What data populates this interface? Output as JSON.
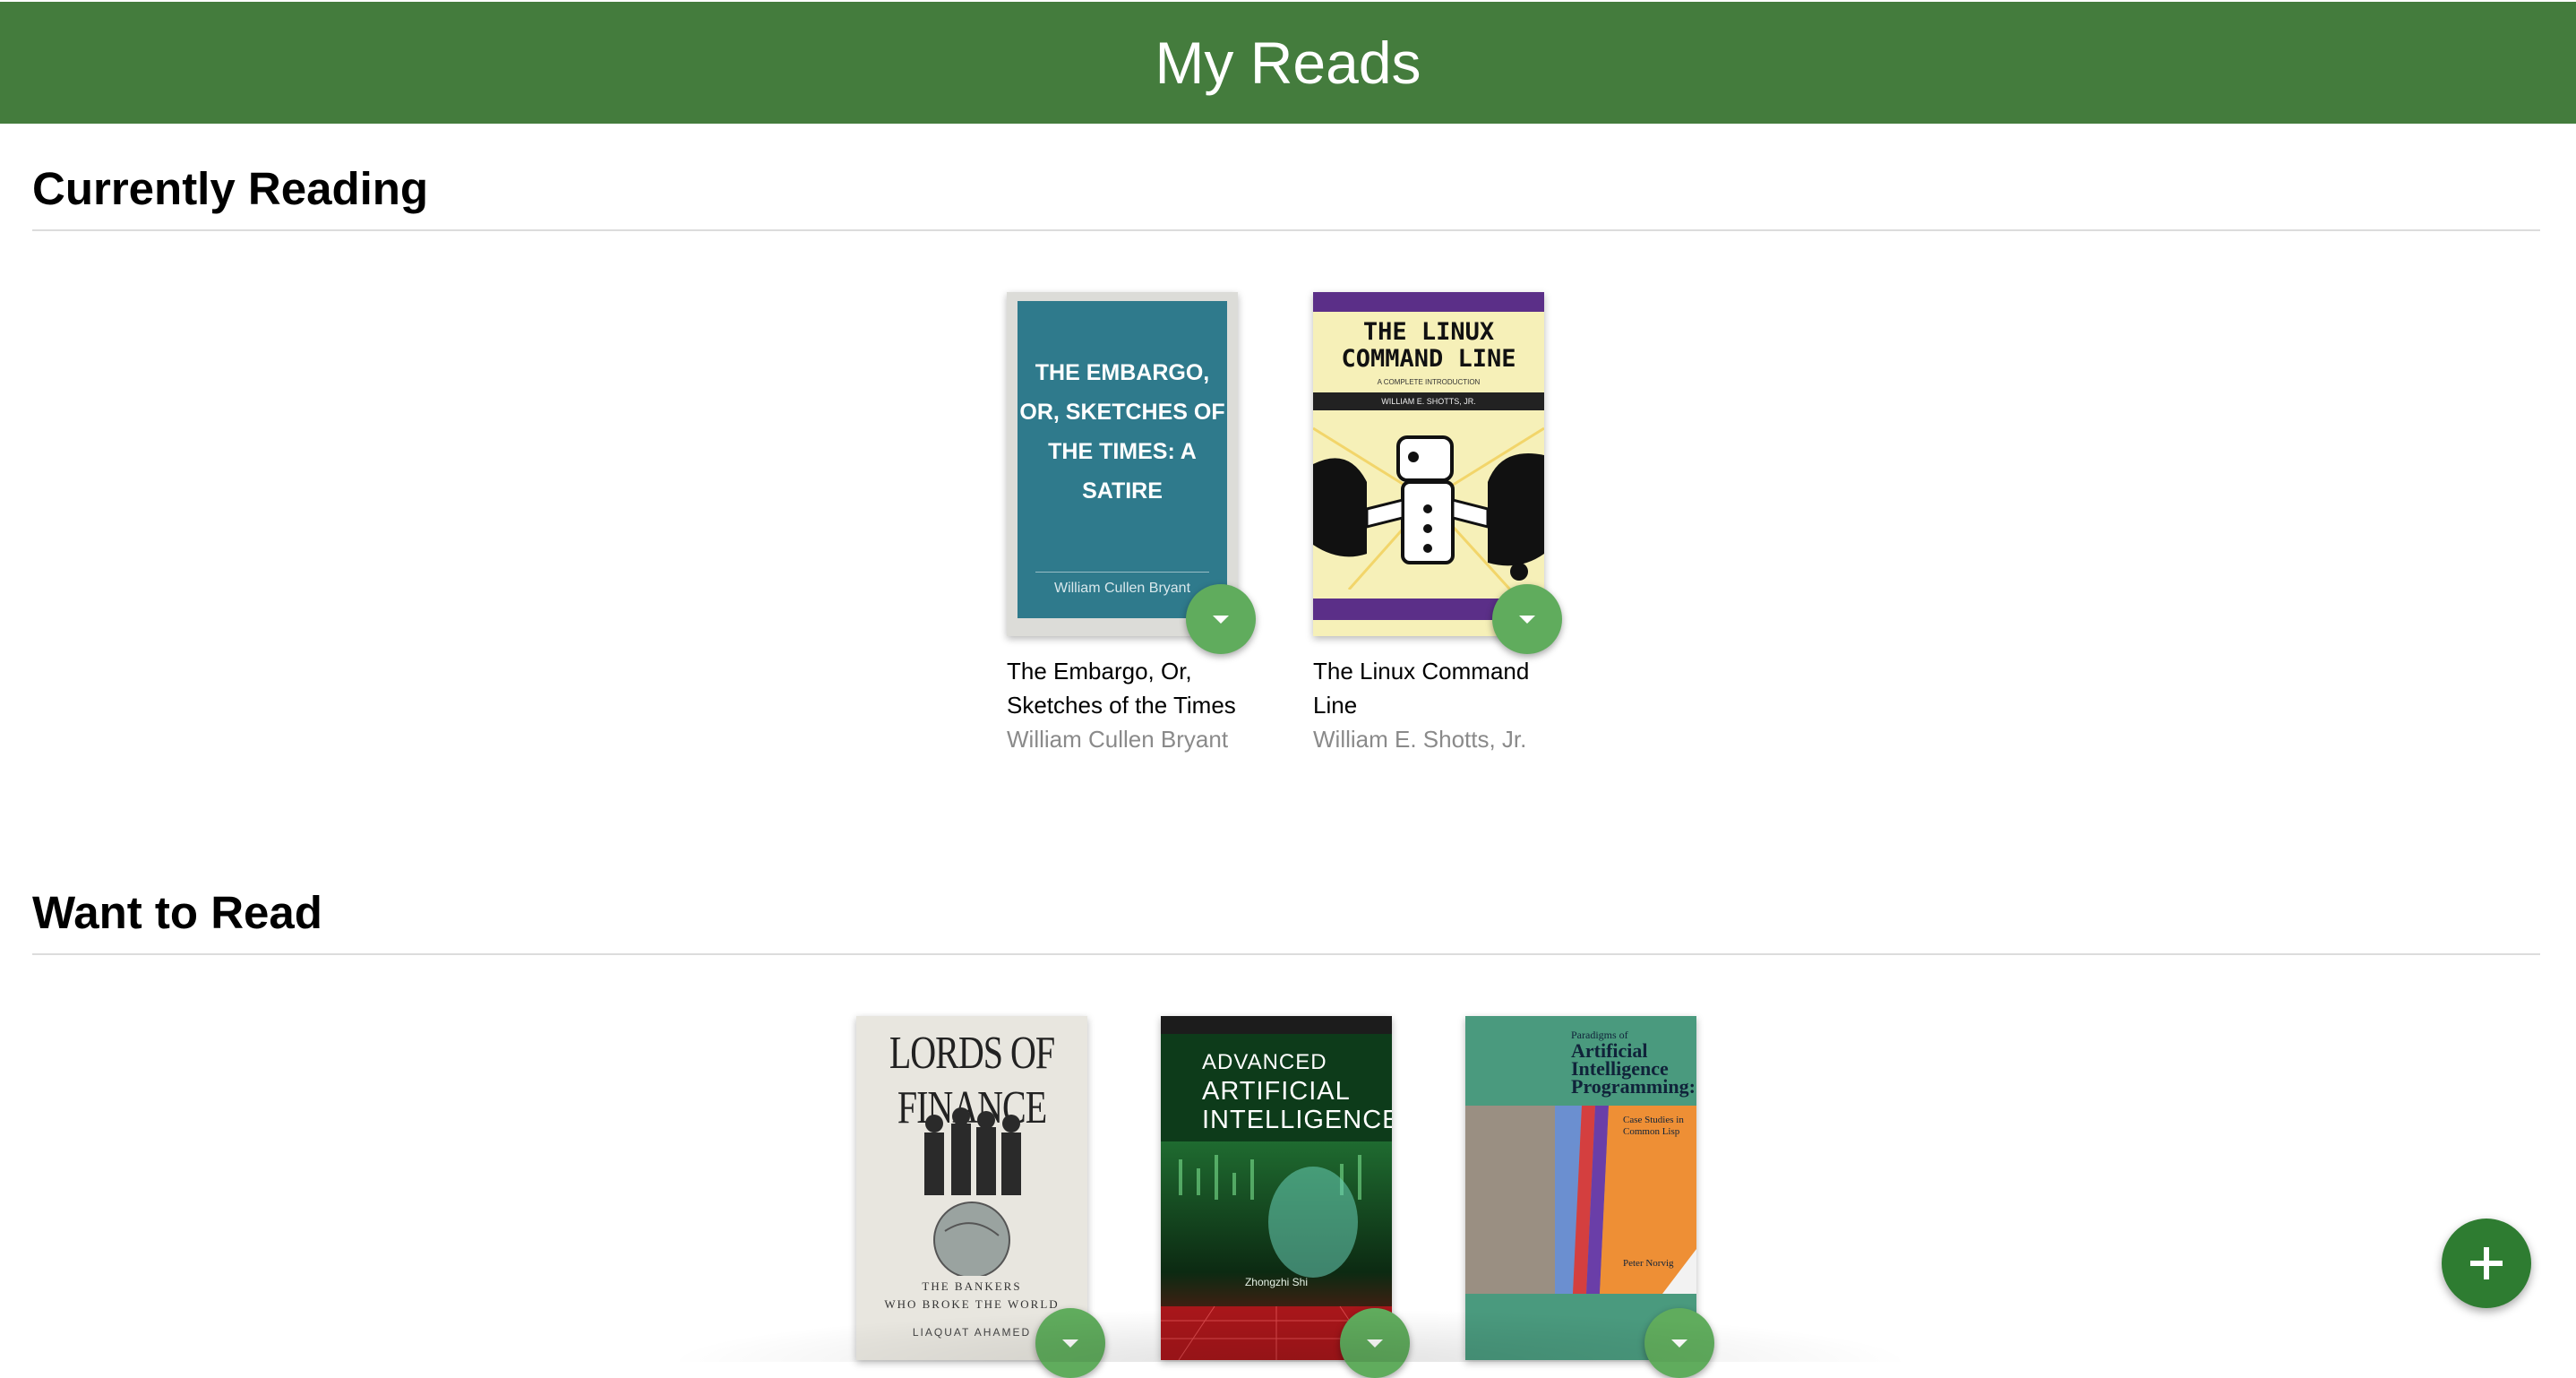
{
  "app": {
    "title": "My Reads"
  },
  "shelves": [
    {
      "title": "Currently Reading",
      "books": [
        {
          "title": "The Embargo, Or, Sketches of the Times",
          "authors": "William Cullen Bryant",
          "cover_text": [
            "THE EMBARGO,",
            "OR, SKETCHES OF",
            "THE TIMES: A",
            "SATIRE"
          ],
          "cover_author": "William Cullen Bryant",
          "cover_color": "#2f7a8c"
        },
        {
          "title": "The Linux Command Line",
          "authors": "William E. Shotts, Jr.",
          "cover_text": [
            "THE LINUX",
            "COMMAND LINE"
          ],
          "cover_subtitle": "A COMPLETE INTRODUCTION",
          "cover_author": "WILLIAM E. SHOTTS, JR.",
          "cover_color": "#f6f0b8"
        }
      ]
    },
    {
      "title": "Want to Read",
      "books": [
        {
          "title": "",
          "authors": "",
          "cover_text": [
            "LORDS OF FINANCE"
          ],
          "cover_subtitle": [
            "THE BANKERS",
            "WHO BROKE THE WORLD"
          ],
          "cover_author": "LIAQUAT AHAMED",
          "cover_color": "#e8e6df"
        },
        {
          "title": "",
          "authors": "",
          "cover_text": [
            "ADVANCED",
            "ARTIFICIAL",
            "INTELLIGENCE"
          ],
          "cover_author": "Zhongzhi Shi",
          "cover_color": "#0d3b1a"
        },
        {
          "title": "",
          "authors": "",
          "cover_text": [
            "Artificial",
            "Intelligence",
            "Programming:"
          ],
          "cover_subtitle": [
            "Case Studies in",
            "Common Lisp"
          ],
          "cover_pre": "Paradigms of",
          "cover_author": "Peter Norvig",
          "cover_color": "#4a9a7e"
        }
      ]
    }
  ],
  "colors": {
    "header": "#447c3d",
    "shelf_changer": "#60ac5d",
    "add_button": "#2e7c31"
  },
  "icons": {
    "shelf_changer": "triangle-down-icon",
    "add": "plus-icon"
  }
}
